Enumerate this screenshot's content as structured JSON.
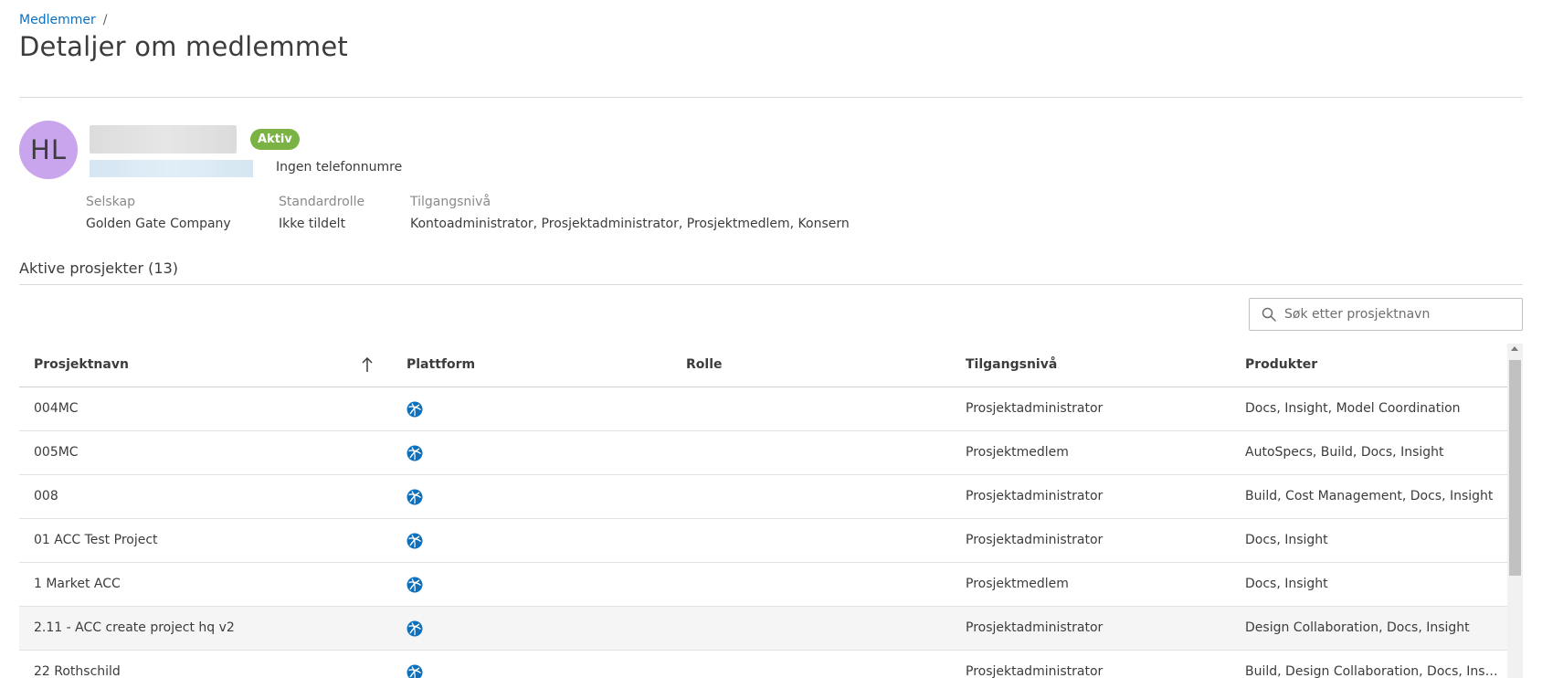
{
  "breadcrumb": {
    "parent": "Medlemmer",
    "separator": "/"
  },
  "page_title": "Detaljer om medlemmet",
  "member": {
    "initials": "HL",
    "status": "Aktiv",
    "phone": "Ingen telefonnumre",
    "company_label": "Selskap",
    "company_value": "Golden Gate Company",
    "role_label": "Standardrolle",
    "role_value": "Ikke tildelt",
    "access_label": "Tilgangsnivå",
    "access_value": "Kontoadministrator, Prosjektadministrator, Prosjektmedlem, Konsern"
  },
  "projects": {
    "section_title": "Aktive prosjekter (13)",
    "search_placeholder": "Søk etter prosjektnavn",
    "columns": {
      "name": "Prosjektnavn",
      "platform": "Plattform",
      "role": "Rolle",
      "access": "Tilgangsnivå",
      "products": "Produkter"
    },
    "rows": [
      {
        "name": "004MC",
        "platform_icon": "globe-icon",
        "role": "",
        "access": "Prosjektadministrator",
        "products": "Docs, Insight, Model Coordination"
      },
      {
        "name": "005MC",
        "platform_icon": "globe-icon",
        "role": "",
        "access": "Prosjektmedlem",
        "products": "AutoSpecs, Build, Docs, Insight"
      },
      {
        "name": "008",
        "platform_icon": "globe-icon",
        "role": "",
        "access": "Prosjektadministrator",
        "products": "Build, Cost Management, Docs, Insight"
      },
      {
        "name": "01 ACC Test Project",
        "platform_icon": "globe-icon",
        "role": "",
        "access": "Prosjektadministrator",
        "products": "Docs, Insight"
      },
      {
        "name": "1 Market ACC",
        "platform_icon": "globe-icon",
        "role": "",
        "access": "Prosjektmedlem",
        "products": "Docs, Insight"
      },
      {
        "name": "2.11 - ACC create project hq v2",
        "platform_icon": "globe-icon",
        "role": "",
        "access": "Prosjektadministrator",
        "products": "Design Collaboration, Docs, Insight",
        "highlighted": true
      },
      {
        "name": "22 Rothschild",
        "platform_icon": "globe-icon",
        "role": "",
        "access": "Prosjektadministrator",
        "products": "Build, Design Collaboration, Docs, Insight"
      }
    ]
  },
  "colors": {
    "link": "#0b6fbf",
    "status_active": "#7ab343",
    "avatar": "#c8a5ec",
    "platform_icon": "#0e6fba"
  }
}
